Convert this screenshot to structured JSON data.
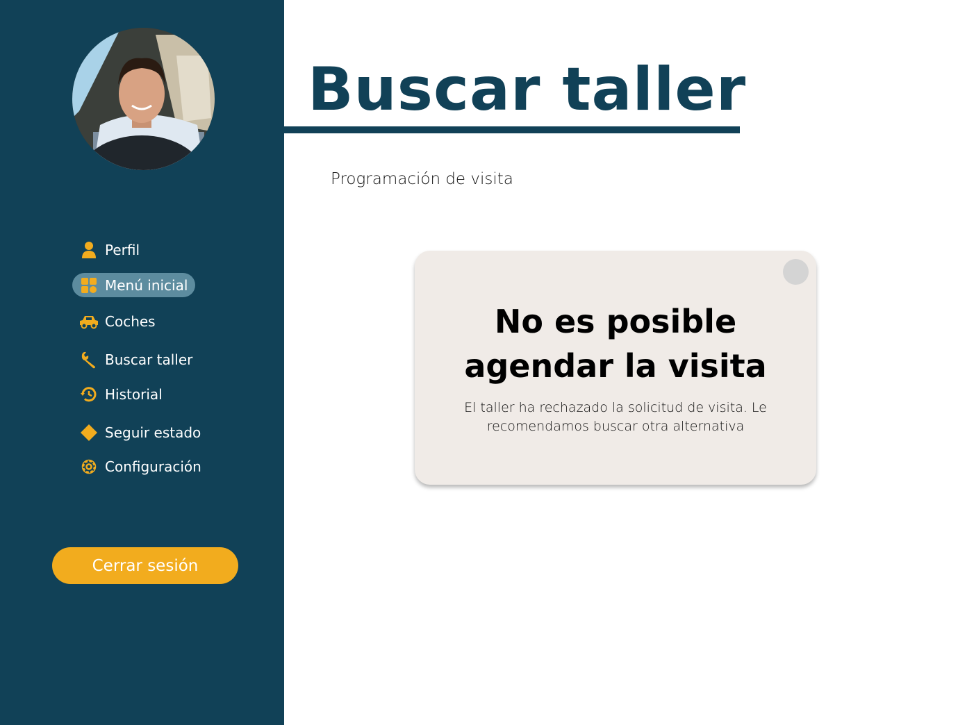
{
  "sidebar": {
    "avatar_icon": "user-photo",
    "items": [
      {
        "label": "Perfil",
        "icon": "person-icon",
        "active": false
      },
      {
        "label": "Menú inicial",
        "icon": "grid-icon",
        "active": true
      },
      {
        "label": "Coches",
        "icon": "car-icon",
        "active": false
      },
      {
        "label": "Buscar taller",
        "icon": "wrench-icon",
        "active": false
      },
      {
        "label": "Historial",
        "icon": "history-icon",
        "active": false
      },
      {
        "label": "Seguir estado",
        "icon": "diamond-icon",
        "active": false
      },
      {
        "label": "Configuración",
        "icon": "gear-icon",
        "active": false
      }
    ],
    "logout_label": "Cerrar sesión"
  },
  "header": {
    "title": "Buscar taller"
  },
  "main": {
    "subtitle": "Programación de visita"
  },
  "modal": {
    "title_line1": "No es posible",
    "title_line2": "agendar la visita",
    "message_line1": "El taller ha rechazado la solicitud de visita. Le",
    "message_line2": "recomendamos buscar otra alternativa"
  },
  "colors": {
    "sidebar_bg": "#114157",
    "accent": "#f2ac1e",
    "active_item_bg": "#5d8c9f",
    "title": "#114157",
    "modal_bg": "#f0ebe7"
  }
}
